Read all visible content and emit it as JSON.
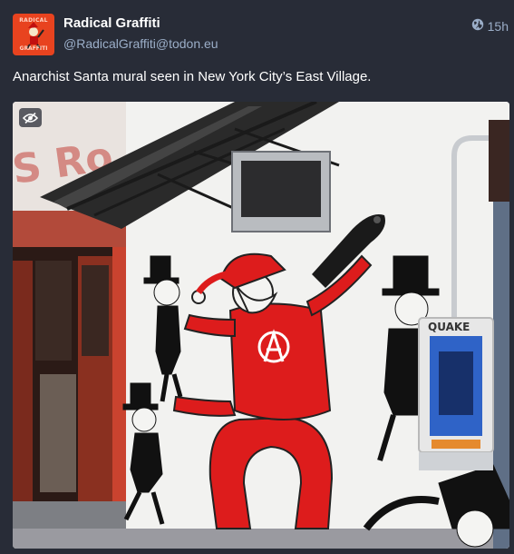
{
  "post": {
    "display_name": "Radical Graffiti",
    "handle": "@RadicalGraffiti@todon.eu",
    "time": "15h",
    "text": "Anarchist Santa mural seen in New York City’s East Village.",
    "avatar_top_text": "RADICAL",
    "avatar_bottom_text": "GRAFFITI",
    "visibility_icon": "globe-icon",
    "media_toggle_icon": "eye-slash-icon"
  },
  "mural": {
    "tag_text": "QUAKE"
  },
  "colors": {
    "background": "#282c37",
    "secondary_text": "#9baec8",
    "avatar_bg": "#e8431f",
    "santa_red": "#dd1c1c"
  }
}
